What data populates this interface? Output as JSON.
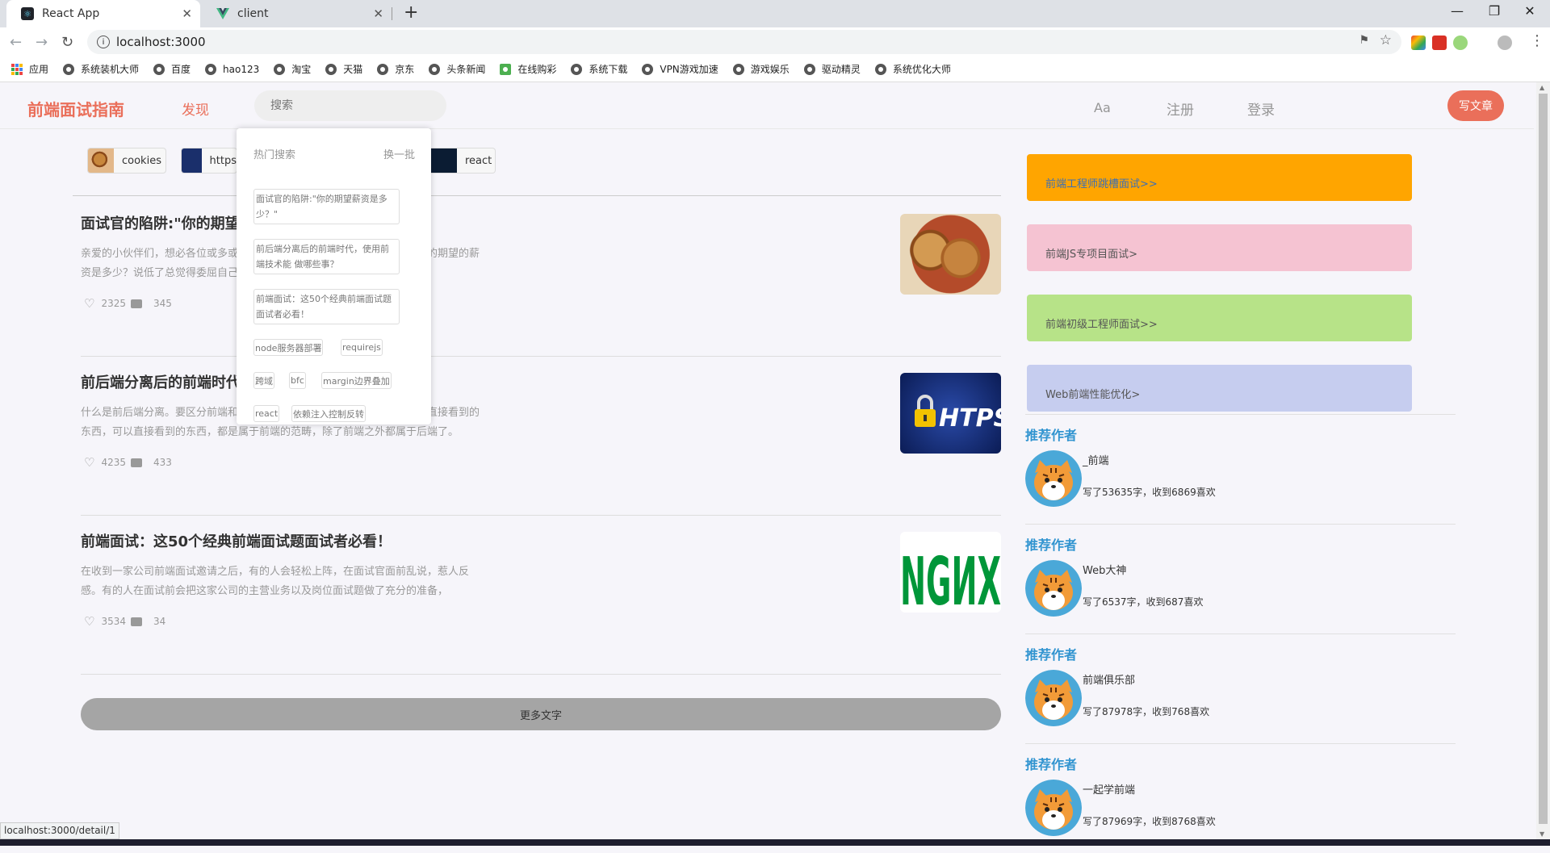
{
  "browser": {
    "tabs": [
      {
        "title": "React App",
        "icon": "react-icon"
      },
      {
        "title": "client",
        "icon": "vue-icon"
      }
    ],
    "new_tab": "+",
    "url": "localhost:3000",
    "bookmarks": [
      "应用",
      "系统装机大师",
      "百度",
      "hao123",
      "淘宝",
      "天猫",
      "京东",
      "头条新闻",
      "在线购彩",
      "系统下载",
      "VPN游戏加速",
      "游戏娱乐",
      "驱动精灵",
      "系统优化大师"
    ],
    "status_url": "localhost:3000/detail/1"
  },
  "header": {
    "logo": "前端面试指南",
    "nav_find": "发现",
    "search_placeholder": "搜索",
    "font_toggle": "Aa",
    "register": "注册",
    "login": "登录",
    "write": "写文章"
  },
  "topics": [
    {
      "label": "cookies"
    },
    {
      "label": "https"
    },
    {
      "label": "react"
    }
  ],
  "hot_search": {
    "title": "热门搜索",
    "switch": "换一批",
    "questions": [
      "面试官的陷阱:\"你的期望薪资是多少？\"",
      "前后端分离后的前端时代，使用前端技术能 做哪些事？",
      "前端面试：这50个经典前端面试题面试者必看！"
    ],
    "tags": [
      "node服务器部署",
      "requirejs",
      "跨域",
      "bfc",
      "margin边界叠加",
      "react",
      "依赖注入控制反转"
    ]
  },
  "articles": [
    {
      "title": "面试官的陷阱:\"你的期望薪资是多少？\"",
      "desc": "亲爱的小伙伴们，想必各位或多或少都遇到过这样的问题，面试官问你，你的期望的薪资是多少？说低了总觉得委屈自己，说高了又怕被直接淘汰。",
      "likes": "2325",
      "comments": "345",
      "image": "cookies-photo"
    },
    {
      "title": "前后端分离后的前端时代，使用前端技术能做哪些事？",
      "desc": "什么是前后端分离。要区分前端和后端，我们通常认为，前端就是用户能够直接看到的东西，可以直接看到的东西，都是属于前端的范畴，除了前端之外都属于后端了。",
      "likes": "4235",
      "comments": "433",
      "image": "https-lock-photo"
    },
    {
      "title": "前端面试：这50个经典前端面试题面试者必看！",
      "desc": "在收到一家公司前端面试邀请之后，有的人会轻松上阵，在面试官面前乱说，惹人反感。有的人在面试前会把这家公司的主营业务以及岗位面试题做了充分的准备，",
      "likes": "3534",
      "comments": "34",
      "image": "nginx-logo"
    }
  ],
  "more_button": "更多文字",
  "banners": [
    {
      "label": "前端工程师跳槽面试>>",
      "color": "#ffa500"
    },
    {
      "label": "前端JS专项目面试>",
      "color": "#f5c3d2"
    },
    {
      "label": "前端初级工程师面试>>",
      "color": "#b7e388"
    },
    {
      "label": "Web前端性能优化>",
      "color": "#c6cdef"
    }
  ],
  "recommended": [
    {
      "title": "推荐作者",
      "name": "_前端",
      "stats": "写了53635字，收到6869喜欢"
    },
    {
      "title": "推荐作者",
      "name": "Web大神",
      "stats": "写了6537字，收到687喜欢"
    },
    {
      "title": "推荐作者",
      "name": "前端俱乐部",
      "stats": "写了87978字，收到768喜欢"
    },
    {
      "title": "推荐作者",
      "name": "一起学前端",
      "stats": "写了87969字，收到8768喜欢"
    }
  ]
}
